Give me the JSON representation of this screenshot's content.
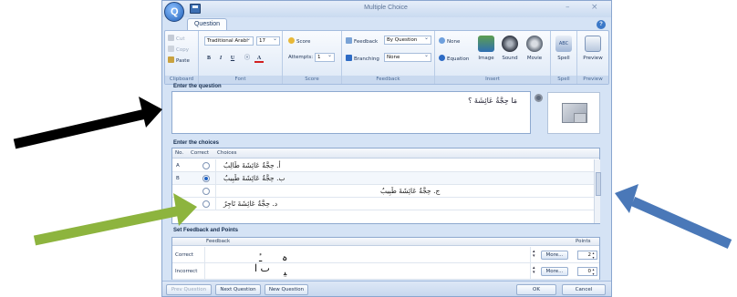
{
  "window": {
    "title": "Multiple Choice",
    "minimize": "–",
    "close": "×",
    "help": "?"
  },
  "tabs": [
    {
      "label": "Question"
    }
  ],
  "ribbon": {
    "clipboard": {
      "label": "Clipboard",
      "cut": "Cut",
      "copy": "Copy",
      "paste": "Paste"
    },
    "font": {
      "label": "Font",
      "family": "Traditional Arabi",
      "size": "17",
      "bold": "B",
      "italic": "I",
      "underline": "U",
      "color": "A"
    },
    "score": {
      "label": "Score",
      "score_btn": "Score",
      "attempts_label": "Attempts:",
      "attempts_value": "1"
    },
    "feedback": {
      "label": "Feedback",
      "feedback_btn": "Feedback",
      "feedback_value": "By Question",
      "branching_btn": "Branching",
      "branching_value": "None"
    },
    "insert": {
      "label": "Insert",
      "none": "None",
      "equation": "Equation",
      "image": "Image",
      "sound": "Sound",
      "movie": "Movie"
    },
    "spell": {
      "label": "Spell",
      "button": "Spell"
    },
    "preview": {
      "label": "Preview",
      "button": "Preview"
    }
  },
  "question": {
    "section_label": "Enter the question",
    "text": "مَا حِجَّةُ عَائِشَةَ ؟"
  },
  "choices": {
    "section_label": "Enter the choices",
    "headers": {
      "no": "No.",
      "correct": "Correct",
      "choices": "Choices"
    },
    "rows": [
      {
        "letter": "A",
        "correct": false,
        "text": "أ. حِجَّةُ عَائِشَةَ طَالِبٌ"
      },
      {
        "letter": "B",
        "correct": true,
        "text": "ب. حِجَّةُ عَائِشَةَ طَبِيبٌ"
      },
      {
        "letter": "",
        "correct": false,
        "text": "ج. حِجَّةُ عَائِشَةَ طَبِيبٌ"
      },
      {
        "letter": "",
        "correct": false,
        "text": "د. حِجَّةُ عَائِشَةَ تَاجِرٌ"
      }
    ]
  },
  "feedback": {
    "section_label": "Set Feedback and Points",
    "headers": {
      "feedback": "Feedback",
      "points": "Points"
    },
    "rows": [
      {
        "label": "Correct",
        "more": "More...",
        "points": "2"
      },
      {
        "label": "Incorrect",
        "more": "More...",
        "points": "0"
      }
    ]
  },
  "footer": {
    "prev": "Prev Question",
    "next": "Next Question",
    "new": "New Question",
    "ok": "OK",
    "cancel": "Cancel"
  },
  "colors": {
    "arrow_black": "#000000",
    "arrow_green": "#8db43e",
    "arrow_blue": "#4a78b8"
  }
}
